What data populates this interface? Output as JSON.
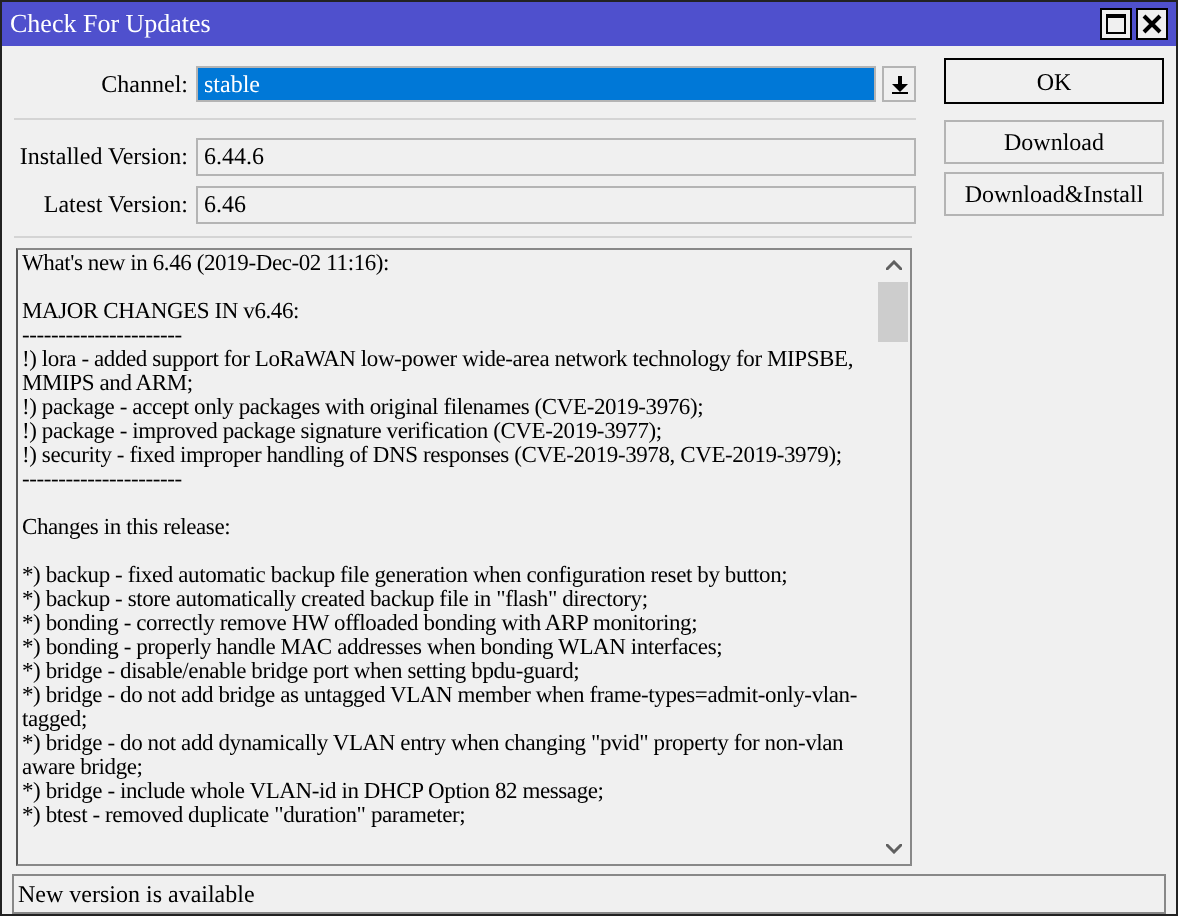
{
  "window": {
    "title": "Check For Updates"
  },
  "channel": {
    "label": "Channel:",
    "value": "stable"
  },
  "installed": {
    "label": "Installed Version:",
    "value": "6.44.6"
  },
  "latest": {
    "label": "Latest Version:",
    "value": "6.46"
  },
  "buttons": [
    "OK",
    "Download",
    "Download&Install"
  ],
  "notes": [
    [
      "What's new in 6.46 (2019-Dec-02 11:16):"
    ],
    [
      "MAJOR CHANGES IN v6.46:",
      "----------------------",
      "!) lora - added support for LoRaWAN low-power wide-area network technology for MIPSBE, MMIPS and ARM;",
      "!) package - accept only packages with original filenames (CVE-2019-3976);",
      "!) package - improved package signature verification (CVE-2019-3977);",
      "!) security - fixed improper handling of DNS responses (CVE-2019-3978, CVE-2019-3979);",
      "----------------------"
    ],
    [
      "Changes in this release:"
    ],
    [
      "*) backup - fixed automatic backup file generation when configuration reset by button;",
      "*) backup - store automatically created backup file in \"flash\" directory;",
      "*) bonding - correctly remove HW offloaded bonding with ARP monitoring;",
      "*) bonding - properly handle MAC addresses when bonding WLAN interfaces;",
      "*) bridge - disable/enable bridge port when setting bpdu-guard;",
      "*) bridge - do not add bridge as untagged VLAN member when frame-types=admit-only-vlan-tagged;",
      "*) bridge - do not add dynamically VLAN entry when changing \"pvid\" property for non-vlan aware bridge;",
      "*) bridge - include whole VLAN-id in DHCP Option 82 message;",
      "*) btest - removed duplicate \"duration\" parameter;"
    ]
  ],
  "status_bar": "New version is available"
}
